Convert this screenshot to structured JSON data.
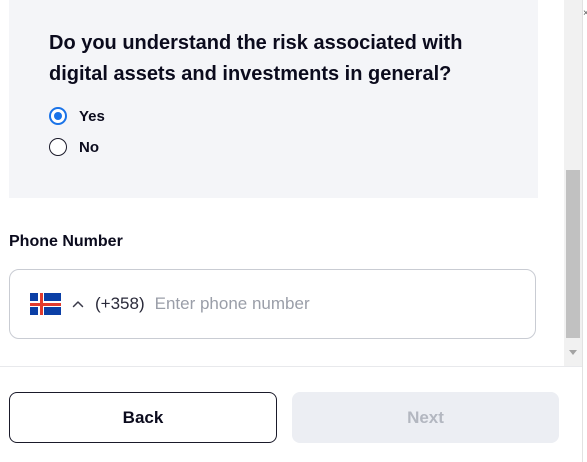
{
  "question": {
    "text": "Do you understand the risk associated with digital assets and investments in general?",
    "options": [
      {
        "label": "Yes",
        "selected": true
      },
      {
        "label": "No",
        "selected": false
      }
    ]
  },
  "phone": {
    "label": "Phone Number",
    "country_flag": "iceland-flag",
    "dial_code": "(+358)",
    "placeholder": "Enter phone number",
    "value": ""
  },
  "footer": {
    "back_label": "Back",
    "next_label": "Next"
  },
  "colors": {
    "accent": "#1a73e8",
    "card_bg": "#f4f5f8",
    "disabled_bg": "#eceef3",
    "disabled_text": "#b3b7c0"
  }
}
